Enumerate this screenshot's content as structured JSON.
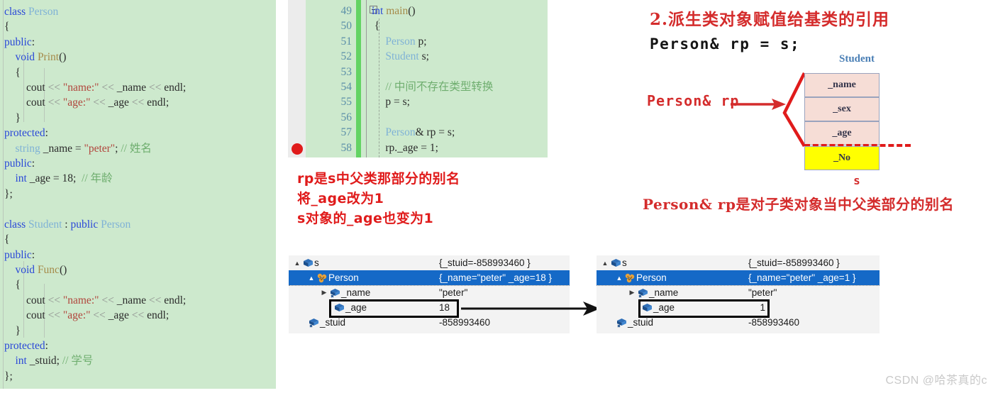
{
  "left_code_panel": {
    "name": "Person and Student class definition",
    "background": "#cde9cd",
    "lines": [
      "class Person",
      "{",
      "public:",
      "    void Print()",
      "    {",
      "        cout << \"name:\" << _name << endl;",
      "        cout << \"age:\" << _age << endl;",
      "    }",
      "protected:",
      "    string _name = \"peter\"; // 姓名",
      "public:",
      "    int _age = 18;  // 年龄",
      "};",
      "",
      "class Student : public Person",
      "{",
      "public:",
      "    void Func()",
      "    {",
      "        cout << \"name:\" << _name << endl;",
      "        cout << \"age:\" << _age << endl;",
      "    }",
      "protected:",
      "    int _stuid; // 学号",
      "};"
    ]
  },
  "mid_code_panel": {
    "name": "main function editor",
    "background": "#cde9cd",
    "line_numbers": [
      "49",
      "50",
      "51",
      "52",
      "53",
      "54",
      "55",
      "56",
      "57",
      "58"
    ],
    "lines": [
      "int main()",
      "{",
      "    Person p;",
      "    Student s;",
      "",
      "    // 中间不存在类型转换",
      "    p = s;",
      "",
      "    Person& rp = s;",
      "    rp._age = 1;"
    ],
    "breakpoint_line": "58",
    "collapse_marker": "-"
  },
  "mid_note": {
    "name": "red annotation under middle code",
    "color": "#e01b1b",
    "lines": [
      "rp是s中父类那部分的别名",
      "将_age改为1",
      "s对象的_age也变为1"
    ]
  },
  "right_panel": {
    "title": "2.派生类对象赋值给基类的引用",
    "title_color": "#d42c2c",
    "subtitle": "Person& rp = s;",
    "note": "Person& rp是对子类对象当中父类部分的别名",
    "note_color": "#d42c2c"
  },
  "mem_diagram": {
    "name": "Student object memory layout",
    "class_title": "Student",
    "class_title_color": "#4a7fb5",
    "object_caption": "s",
    "pointer_label": "Person& rp",
    "pointer_label_color": "#d42c2c",
    "members": [
      {
        "label": "_name",
        "color": "#f6ddd6"
      },
      {
        "label": "_sex",
        "color": "#f6ddd6"
      },
      {
        "label": "_age",
        "color": "#f6ddd6"
      },
      {
        "label": "_No",
        "color": "#ffff00"
      }
    ]
  },
  "watch_left": {
    "name": "debug watch before modification",
    "rows": [
      {
        "expander": "▲",
        "icon": "cube-icon",
        "indent": 0,
        "label": "s",
        "value": "{_stuid=-858993460 }",
        "selected": false
      },
      {
        "expander": "▲",
        "icon": "braces-icon",
        "indent": 1,
        "label": "Person",
        "value": "{_name=\"peter\" _age=18 }",
        "selected": true
      },
      {
        "expander": "▶",
        "icon": "field-icon",
        "indent": 2,
        "label": "_name",
        "value": "\"peter\"",
        "selected": false
      },
      {
        "expander": "",
        "icon": "cube-icon",
        "indent": 2,
        "label": "_age",
        "value": "18",
        "selected": false
      },
      {
        "expander": "",
        "icon": "field-icon",
        "indent": 1,
        "label": "_stuid",
        "value": "-858993460",
        "selected": false
      }
    ],
    "highlight_row_label": "_age"
  },
  "watch_right": {
    "name": "debug watch after modification",
    "rows": [
      {
        "expander": "▲",
        "icon": "cube-icon",
        "indent": 0,
        "label": "s",
        "value": "{_stuid=-858993460 }",
        "selected": false
      },
      {
        "expander": "▲",
        "icon": "braces-icon",
        "indent": 1,
        "label": "Person",
        "value": "{_name=\"peter\" _age=1 }",
        "selected": true
      },
      {
        "expander": "▶",
        "icon": "field-icon",
        "indent": 2,
        "label": "_name",
        "value": "\"peter\"",
        "selected": false
      },
      {
        "expander": "",
        "icon": "cube-icon",
        "indent": 2,
        "label": "_age",
        "value": "1",
        "selected": false
      },
      {
        "expander": "",
        "icon": "field-icon",
        "indent": 1,
        "label": "_stuid",
        "value": "-858993460",
        "selected": false
      }
    ],
    "highlight_row_label": "_age",
    "pin_marker": "⊷"
  },
  "watermark": "CSDN @哈茶真的c"
}
